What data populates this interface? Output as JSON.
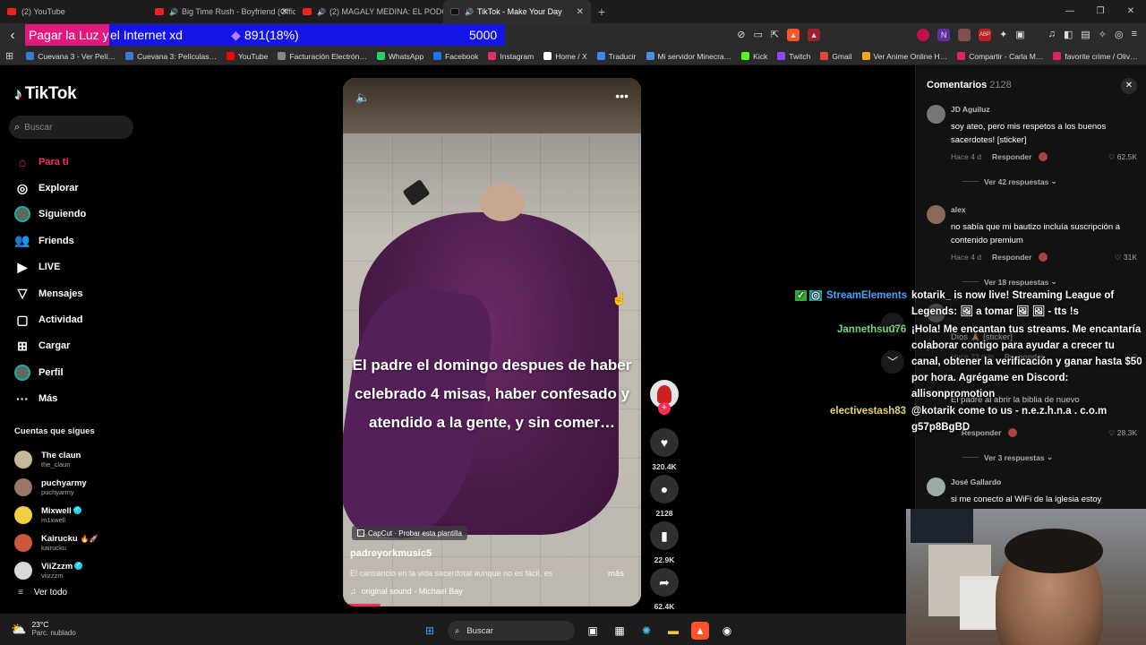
{
  "browser": {
    "tabs": [
      {
        "title": "(2) YouTube",
        "favicon": "youtube-icon",
        "audio": false
      },
      {
        "title": "Big Time Rush - Boyfriend (Offici…",
        "favicon": "youtube-icon",
        "audio": true
      },
      {
        "title": "(2) MAGALY MEDINA: EL PODCAST -",
        "favicon": "youtube-icon",
        "audio": true
      },
      {
        "title": "TikTok - Make Your Day",
        "favicon": "tiktok-icon",
        "audio": true,
        "active": true
      }
    ],
    "new_tab": "+",
    "bookmarks": [
      {
        "label": "Cuevana 3 - Ver Pelí…",
        "color": "#3a7bd5"
      },
      {
        "label": "Cuevana 3: Películas…",
        "color": "#3a7bd5"
      },
      {
        "label": "YouTube",
        "color": "#ff0000"
      },
      {
        "label": "Facturación Electrón…",
        "color": "#888888"
      },
      {
        "label": "WhatsApp",
        "color": "#25d366"
      },
      {
        "label": "Facebook",
        "color": "#1877f2"
      },
      {
        "label": "Instagram",
        "color": "#e1306c"
      },
      {
        "label": "Home / X",
        "color": "#ffffff"
      },
      {
        "label": "Traducir",
        "color": "#4285f4"
      },
      {
        "label": "Mi servidor Minecra…",
        "color": "#4a90e2"
      },
      {
        "label": "Kick",
        "color": "#53fc18"
      },
      {
        "label": "Twitch",
        "color": "#9146ff"
      },
      {
        "label": "Gmail",
        "color": "#ea4335"
      },
      {
        "label": "Ver Anime Online H…",
        "color": "#f5a623"
      },
      {
        "label": "Compartir - Carla M…",
        "color": "#e0245e"
      },
      {
        "label": "favorite crime / Oliv…",
        "color": "#e0245e"
      }
    ]
  },
  "stream_goal": {
    "left_text": "Pagar la Luz y",
    "right_text": "el Internet xd",
    "count": "891(18%)",
    "goal": "5000",
    "progress_fraction": 0.18,
    "bar_color": "#1414e6",
    "accent_color": "#e0197d"
  },
  "tiktok": {
    "logo": "TikTok",
    "search_placeholder": "Buscar",
    "nav": [
      {
        "label": "Para ti",
        "icon": "home-icon",
        "active": true
      },
      {
        "label": "Explorar",
        "icon": "compass-icon"
      },
      {
        "label": "Siguiendo",
        "icon": "avatar-icon"
      },
      {
        "label": "Friends",
        "icon": "friends-icon"
      },
      {
        "label": "LIVE",
        "icon": "live-icon"
      },
      {
        "label": "Mensajes",
        "icon": "messages-icon"
      },
      {
        "label": "Actividad",
        "icon": "activity-icon"
      },
      {
        "label": "Cargar",
        "icon": "upload-icon"
      },
      {
        "label": "Perfil",
        "icon": "profile-icon"
      },
      {
        "label": "Más",
        "icon": "more-icon"
      }
    ],
    "following_title": "Cuentas que sigues",
    "following": [
      {
        "name": "The claun",
        "user": "the_claun",
        "verified": false,
        "extra": ""
      },
      {
        "name": "puchyarmy",
        "user": "puchyarmy",
        "verified": false,
        "extra": ""
      },
      {
        "name": "Mixwell",
        "user": "m1xwell",
        "verified": true,
        "extra": ""
      },
      {
        "name": "Kairucku",
        "user": "kairucku",
        "verified": false,
        "extra": "🔥🚀"
      },
      {
        "name": "ViiZzzm",
        "user": "viizzzm",
        "verified": true,
        "extra": ""
      }
    ],
    "see_all": "Ver todo",
    "video": {
      "caption": "El padre el domingo despues de haber celebrado 4 misas, haber confesado y atendido a la gente, y sin comer…",
      "capcut": "CapCut · Probar esta plantilla",
      "username": "padreyorkmusic5",
      "description": "El cansancio en la vida sacerdotal aunque no es fácil, es",
      "more": "más",
      "sound": "original sound - Michael Bay",
      "likes": "320.4K",
      "comments": "2128",
      "saves": "22.9K",
      "shares": "62.4K"
    },
    "comments_panel": {
      "title": "Comentarios",
      "count": "2128",
      "items": [
        {
          "user": "JD Aguiluz",
          "text": "soy ateo, pero mis respetos a los buenos sacerdotes! [sticker]",
          "time": "Hace 4 d",
          "reply": "Responder",
          "likes": "62.5K",
          "replies": "Ver 42 respuestas"
        },
        {
          "user": "alex",
          "text": "no sabía que mi bautizo incluía suscripción a contenido premium",
          "time": "Hace 4 d",
          "reply": "Responder",
          "likes": "31K",
          "replies": "Ver 18 respuestas"
        },
        {
          "user": "",
          "text": "Dios 🙏 [sticker]",
          "time": "Hace 23 min",
          "reply": "Responder",
          "likes": "0",
          "replies": ""
        },
        {
          "user": "",
          "text": "El padre al abrir la biblia de nuevo",
          "time": "",
          "reply": "Responder",
          "likes": "28.3K",
          "replies": "Ver 3 respuestas"
        },
        {
          "user": "José Gallardo",
          "text": "si me conecto al WiFi de la iglesia estoy",
          "time": "",
          "reply": "",
          "likes": "",
          "replies": ""
        }
      ]
    }
  },
  "chat": [
    {
      "name": "StreamElements",
      "name_color": "#4aa3ff",
      "text": "kotarik_ is now live! Streaming League of Legends: 🖼 a tomar 🖼 🖼 - tts !s"
    },
    {
      "name": "Jannethsuu76",
      "name_color": "#7ad67a",
      "text": "¡Hola! Me encantan tus streams. Me encantaría colaborar contigo para ayudar a crecer tu canal, obtener la verificación y ganar hasta $50 por hora. Agrégame en Discord: allisonpromotion"
    },
    {
      "name": "electivestash83",
      "name_color": "#e8d36b",
      "text": "@kotarik come to us - n.e.z.h.n.a . c.o.m g57p8BgBD"
    }
  ],
  "taskbar": {
    "temp": "23°C",
    "weather": "Parc. nublado",
    "search": "Buscar"
  }
}
